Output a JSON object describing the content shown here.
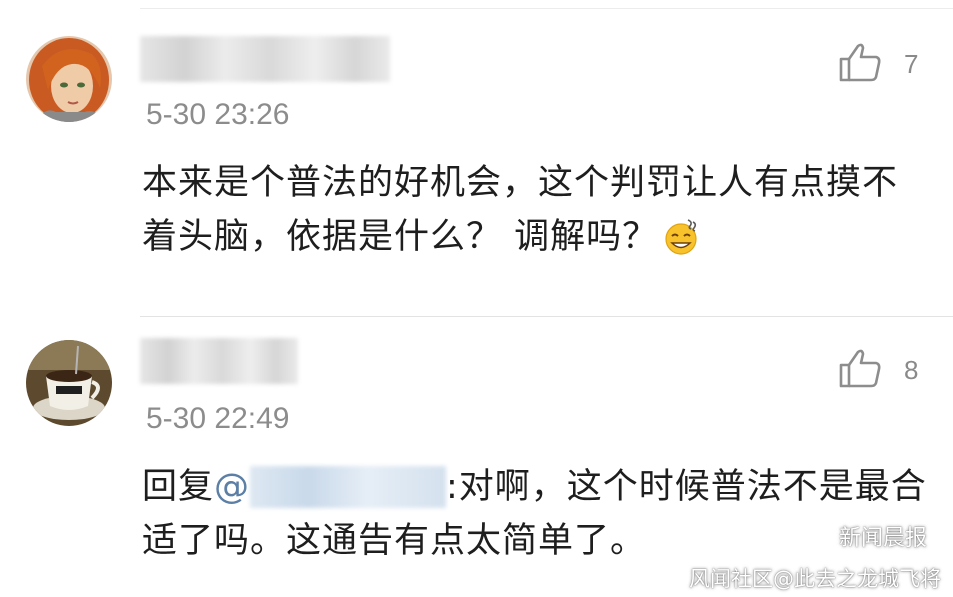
{
  "comments": [
    {
      "likes": "7",
      "time": "5-30 23:26",
      "text": "本来是个普法的好机会，这个判罚让人有点摸不着头脑，依据是什么？ 调解吗？",
      "emoji": "sweat-smile-face-icon"
    },
    {
      "likes": "8",
      "time": "5-30 22:49",
      "reply_prefix": "回复",
      "at_symbol": "@",
      "text_after_mention": ":对啊，这个时候普法不是最合适了吗。这通告有点太简单了。"
    }
  ],
  "watermark": {
    "label": "新闻晨报",
    "icon": "wechat-icon"
  },
  "footer_credit": "风闻社区@此去之龙城飞将",
  "colors": {
    "meta_gray": "#8c8c8c",
    "mention_blue": "#5c7fa6",
    "text": "#1e1e1e"
  }
}
